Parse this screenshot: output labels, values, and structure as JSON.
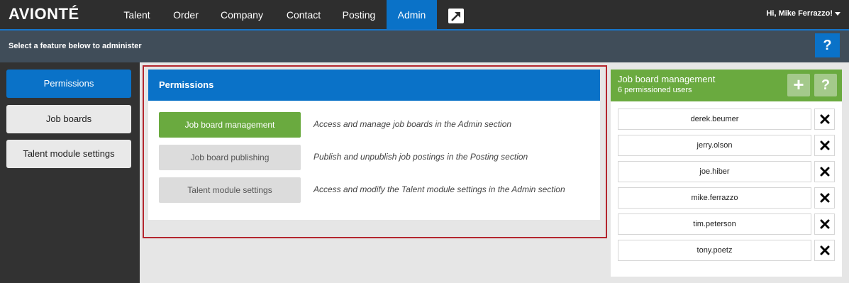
{
  "header": {
    "logo": "AVIONTÉ",
    "nav": [
      {
        "label": "Talent",
        "active": false
      },
      {
        "label": "Order",
        "active": false
      },
      {
        "label": "Company",
        "active": false
      },
      {
        "label": "Contact",
        "active": false
      },
      {
        "label": "Posting",
        "active": false
      },
      {
        "label": "Admin",
        "active": true
      }
    ],
    "external_icon": "external-link-icon",
    "user_greeting": "Hi, Mike Ferrazzo!"
  },
  "subheader": {
    "text": "Select a feature below to administer",
    "help_label": "?"
  },
  "sidebar": {
    "items": [
      {
        "label": "Permissions",
        "active": true
      },
      {
        "label": "Job boards",
        "active": false
      },
      {
        "label": "Talent module settings",
        "active": false
      }
    ]
  },
  "permissions_panel": {
    "title": "Permissions",
    "rows": [
      {
        "button": "Job board management",
        "description": "Access and manage job boards in the Admin section",
        "active": true
      },
      {
        "button": "Job board publishing",
        "description": "Publish and unpublish job postings in the Posting section",
        "active": false
      },
      {
        "button": "Talent module settings",
        "description": "Access and modify the Talent module settings in the Admin section",
        "active": false
      }
    ]
  },
  "users_panel": {
    "title": "Job board management",
    "subtitle": "6 permissioned users",
    "add_label": "+",
    "help_label": "?",
    "users": [
      "derek.beumer",
      "jerry.olson",
      "joe.hiber",
      "mike.ferrazzo",
      "tim.peterson",
      "tony.poetz"
    ]
  },
  "colors": {
    "nav_bg": "#2e2e2e",
    "accent_blue": "#0a72c8",
    "accent_green": "#6aaa3f",
    "highlight_red": "#b4262e"
  }
}
